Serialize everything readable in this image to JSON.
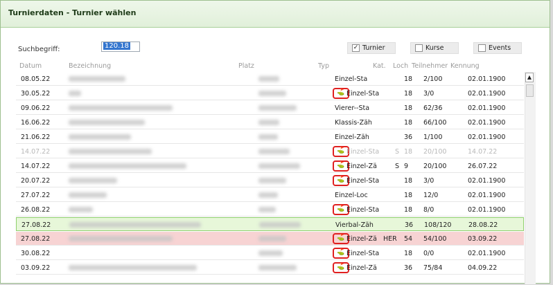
{
  "window": {
    "title": "Turnierdaten - Turnier wählen"
  },
  "search": {
    "label": "Suchbegriff:",
    "value": "120.18"
  },
  "filters": [
    {
      "label": "Turnier",
      "checked": true
    },
    {
      "label": "Kurse",
      "checked": false
    },
    {
      "label": "Events",
      "checked": false
    }
  ],
  "columns": [
    "Datum",
    "Bezeichnung",
    "Platz",
    "Typ",
    "Kat.",
    "Loch",
    "Teilnehmer",
    "Kennung"
  ],
  "rows": [
    {
      "datum": "08.05.22",
      "kat": "Einzel-Sta",
      "loch": "18",
      "teiln": "2/100",
      "kenn": "02.01.1900",
      "icon": false
    },
    {
      "datum": "30.05.22",
      "kat": "Einzel-Sta",
      "loch": "18",
      "teiln": "3/0",
      "kenn": "02.01.1900",
      "icon": true
    },
    {
      "datum": "09.06.22",
      "kat": "Vierer--Sta",
      "loch": "18",
      "teiln": "62/36",
      "kenn": "02.01.1900",
      "icon": false
    },
    {
      "datum": "16.06.22",
      "kat": "Klassis-Zäh",
      "loch": "18",
      "teiln": "66/100",
      "kenn": "02.01.1900",
      "icon": false
    },
    {
      "datum": "21.06.22",
      "kat": "Einzel-Zäh",
      "loch": "36",
      "teiln": "1/100",
      "kenn": "02.01.1900",
      "icon": false
    },
    {
      "datum": "14.07.22",
      "kat": "Einzel-Sta",
      "extra": "S",
      "loch": "18",
      "teiln": "20/100",
      "kenn": "14.07.22",
      "icon": true,
      "dim": true
    },
    {
      "datum": "14.07.22",
      "kat": "Einzel-Zä",
      "extra": "S",
      "loch": "9",
      "teiln": "20/100",
      "kenn": "26.07.22",
      "icon": true
    },
    {
      "datum": "20.07.22",
      "kat": "Einzel-Sta",
      "loch": "18",
      "teiln": "3/0",
      "kenn": "02.01.1900",
      "icon": true
    },
    {
      "datum": "27.07.22",
      "kat": "Einzel-Loc",
      "loch": "18",
      "teiln": "12/0",
      "kenn": "02.01.1900",
      "icon": false
    },
    {
      "datum": "26.08.22",
      "kat": "Einzel-Sta",
      "loch": "18",
      "teiln": "8/0",
      "kenn": "02.01.1900",
      "icon": true
    },
    {
      "datum": "27.08.22",
      "kat": "Vierbal-Zäh",
      "loch": "36",
      "teiln": "108/120",
      "kenn": "28.08.22",
      "icon": false,
      "state": "green"
    },
    {
      "datum": "27.08.22",
      "kat": "Einzel-Zä",
      "extra": "HER",
      "loch": "54",
      "teiln": "54/100",
      "kenn": "03.09.22",
      "icon": true,
      "state": "red"
    },
    {
      "datum": "30.08.22",
      "kat": "Einzel-Sta",
      "loch": "18",
      "teiln": "0/0",
      "kenn": "02.01.1900",
      "icon": true
    },
    {
      "datum": "03.09.22",
      "kat": "Einzel-Zä",
      "loch": "36",
      "teiln": "75/84",
      "kenn": "04.09.22",
      "icon": true
    }
  ],
  "colors": {
    "title_bg": "#e1f0da",
    "selected_green": "#e7f7d9",
    "marker_green": "#2fbf2f",
    "selected_red": "#f7d3d3",
    "marker_red": "#e01010",
    "highlight_box": "#e02020"
  }
}
